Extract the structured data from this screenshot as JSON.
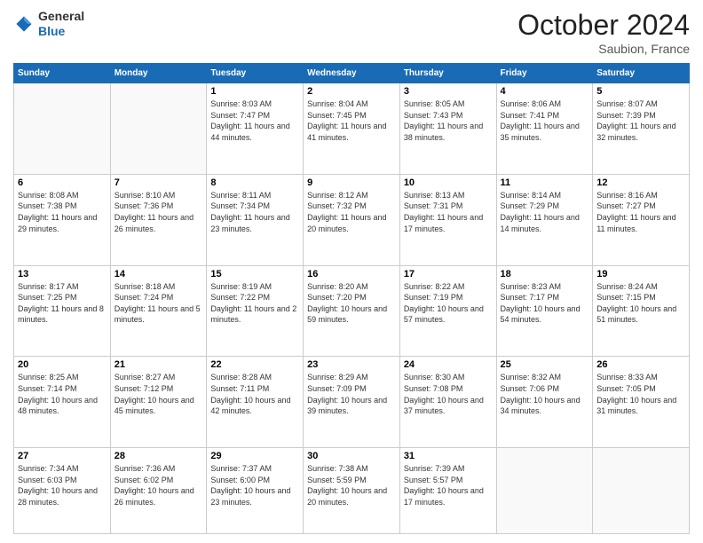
{
  "header": {
    "logo": {
      "general": "General",
      "blue": "Blue"
    },
    "month": "October 2024",
    "location": "Saubion, France"
  },
  "weekdays": [
    "Sunday",
    "Monday",
    "Tuesday",
    "Wednesday",
    "Thursday",
    "Friday",
    "Saturday"
  ],
  "weeks": [
    [
      {
        "day": "",
        "info": ""
      },
      {
        "day": "",
        "info": ""
      },
      {
        "day": "1",
        "info": "Sunrise: 8:03 AM\nSunset: 7:47 PM\nDaylight: 11 hours and 44 minutes."
      },
      {
        "day": "2",
        "info": "Sunrise: 8:04 AM\nSunset: 7:45 PM\nDaylight: 11 hours and 41 minutes."
      },
      {
        "day": "3",
        "info": "Sunrise: 8:05 AM\nSunset: 7:43 PM\nDaylight: 11 hours and 38 minutes."
      },
      {
        "day": "4",
        "info": "Sunrise: 8:06 AM\nSunset: 7:41 PM\nDaylight: 11 hours and 35 minutes."
      },
      {
        "day": "5",
        "info": "Sunrise: 8:07 AM\nSunset: 7:39 PM\nDaylight: 11 hours and 32 minutes."
      }
    ],
    [
      {
        "day": "6",
        "info": "Sunrise: 8:08 AM\nSunset: 7:38 PM\nDaylight: 11 hours and 29 minutes."
      },
      {
        "day": "7",
        "info": "Sunrise: 8:10 AM\nSunset: 7:36 PM\nDaylight: 11 hours and 26 minutes."
      },
      {
        "day": "8",
        "info": "Sunrise: 8:11 AM\nSunset: 7:34 PM\nDaylight: 11 hours and 23 minutes."
      },
      {
        "day": "9",
        "info": "Sunrise: 8:12 AM\nSunset: 7:32 PM\nDaylight: 11 hours and 20 minutes."
      },
      {
        "day": "10",
        "info": "Sunrise: 8:13 AM\nSunset: 7:31 PM\nDaylight: 11 hours and 17 minutes."
      },
      {
        "day": "11",
        "info": "Sunrise: 8:14 AM\nSunset: 7:29 PM\nDaylight: 11 hours and 14 minutes."
      },
      {
        "day": "12",
        "info": "Sunrise: 8:16 AM\nSunset: 7:27 PM\nDaylight: 11 hours and 11 minutes."
      }
    ],
    [
      {
        "day": "13",
        "info": "Sunrise: 8:17 AM\nSunset: 7:25 PM\nDaylight: 11 hours and 8 minutes."
      },
      {
        "day": "14",
        "info": "Sunrise: 8:18 AM\nSunset: 7:24 PM\nDaylight: 11 hours and 5 minutes."
      },
      {
        "day": "15",
        "info": "Sunrise: 8:19 AM\nSunset: 7:22 PM\nDaylight: 11 hours and 2 minutes."
      },
      {
        "day": "16",
        "info": "Sunrise: 8:20 AM\nSunset: 7:20 PM\nDaylight: 10 hours and 59 minutes."
      },
      {
        "day": "17",
        "info": "Sunrise: 8:22 AM\nSunset: 7:19 PM\nDaylight: 10 hours and 57 minutes."
      },
      {
        "day": "18",
        "info": "Sunrise: 8:23 AM\nSunset: 7:17 PM\nDaylight: 10 hours and 54 minutes."
      },
      {
        "day": "19",
        "info": "Sunrise: 8:24 AM\nSunset: 7:15 PM\nDaylight: 10 hours and 51 minutes."
      }
    ],
    [
      {
        "day": "20",
        "info": "Sunrise: 8:25 AM\nSunset: 7:14 PM\nDaylight: 10 hours and 48 minutes."
      },
      {
        "day": "21",
        "info": "Sunrise: 8:27 AM\nSunset: 7:12 PM\nDaylight: 10 hours and 45 minutes."
      },
      {
        "day": "22",
        "info": "Sunrise: 8:28 AM\nSunset: 7:11 PM\nDaylight: 10 hours and 42 minutes."
      },
      {
        "day": "23",
        "info": "Sunrise: 8:29 AM\nSunset: 7:09 PM\nDaylight: 10 hours and 39 minutes."
      },
      {
        "day": "24",
        "info": "Sunrise: 8:30 AM\nSunset: 7:08 PM\nDaylight: 10 hours and 37 minutes."
      },
      {
        "day": "25",
        "info": "Sunrise: 8:32 AM\nSunset: 7:06 PM\nDaylight: 10 hours and 34 minutes."
      },
      {
        "day": "26",
        "info": "Sunrise: 8:33 AM\nSunset: 7:05 PM\nDaylight: 10 hours and 31 minutes."
      }
    ],
    [
      {
        "day": "27",
        "info": "Sunrise: 7:34 AM\nSunset: 6:03 PM\nDaylight: 10 hours and 28 minutes."
      },
      {
        "day": "28",
        "info": "Sunrise: 7:36 AM\nSunset: 6:02 PM\nDaylight: 10 hours and 26 minutes."
      },
      {
        "day": "29",
        "info": "Sunrise: 7:37 AM\nSunset: 6:00 PM\nDaylight: 10 hours and 23 minutes."
      },
      {
        "day": "30",
        "info": "Sunrise: 7:38 AM\nSunset: 5:59 PM\nDaylight: 10 hours and 20 minutes."
      },
      {
        "day": "31",
        "info": "Sunrise: 7:39 AM\nSunset: 5:57 PM\nDaylight: 10 hours and 17 minutes."
      },
      {
        "day": "",
        "info": ""
      },
      {
        "day": "",
        "info": ""
      }
    ]
  ]
}
